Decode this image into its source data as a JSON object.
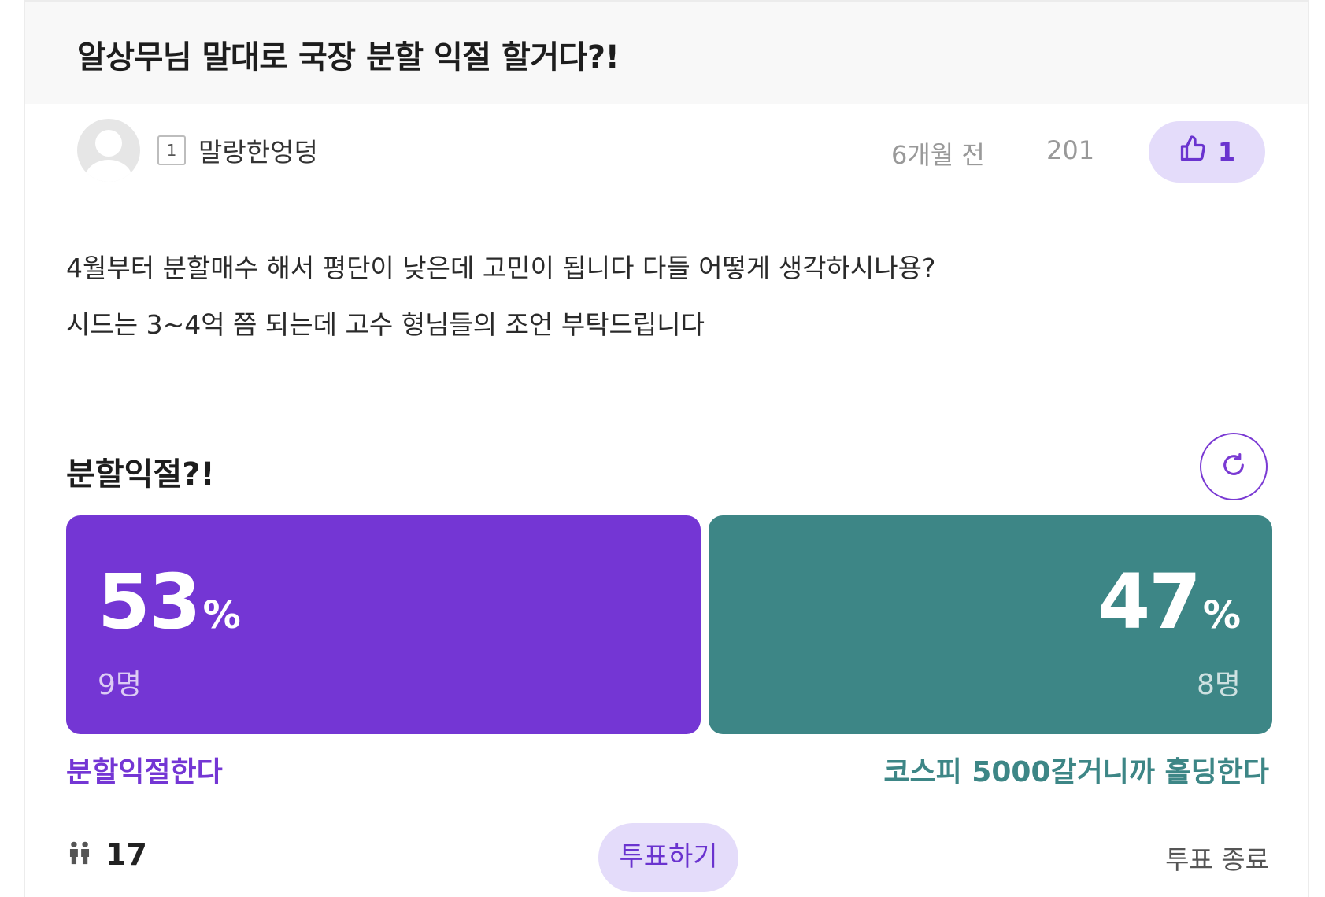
{
  "post": {
    "title": "알상무님 말대로 국장 분할 익절 할거다?!",
    "author": {
      "level": "1",
      "name": "말랑한엉덩"
    },
    "time": "6개월 전",
    "views": "201",
    "likes": "1",
    "body": [
      "4월부터 분할매수 해서 평단이 낮은데 고민이 됩니다 다들 어떻게 생각하시나용?",
      "시드는 3~4억 쯤 되는데 고수 형님들의 조언 부탁드립니다"
    ]
  },
  "poll": {
    "title": "분할익절?!",
    "options": [
      {
        "percent": "53",
        "percent_sign": "%",
        "votes": "9명",
        "label": "분할익절한다",
        "color": "#7436d4",
        "share": 0.53
      },
      {
        "percent": "47",
        "percent_sign": "%",
        "votes": "8명",
        "label": "코스피 5000갈거니까 홀딩한다",
        "color": "#3d8686",
        "share": 0.47
      }
    ],
    "total_voters": "17",
    "vote_button": "투표하기",
    "status": "투표 종료"
  },
  "colors": {
    "accent": "#6a33cf",
    "accent_light": "#e4dcfa",
    "title_bar": "#f8f8f8"
  },
  "icons": {
    "like": "thumbs-up-icon",
    "refresh": "refresh-icon",
    "voters": "people-icon"
  }
}
